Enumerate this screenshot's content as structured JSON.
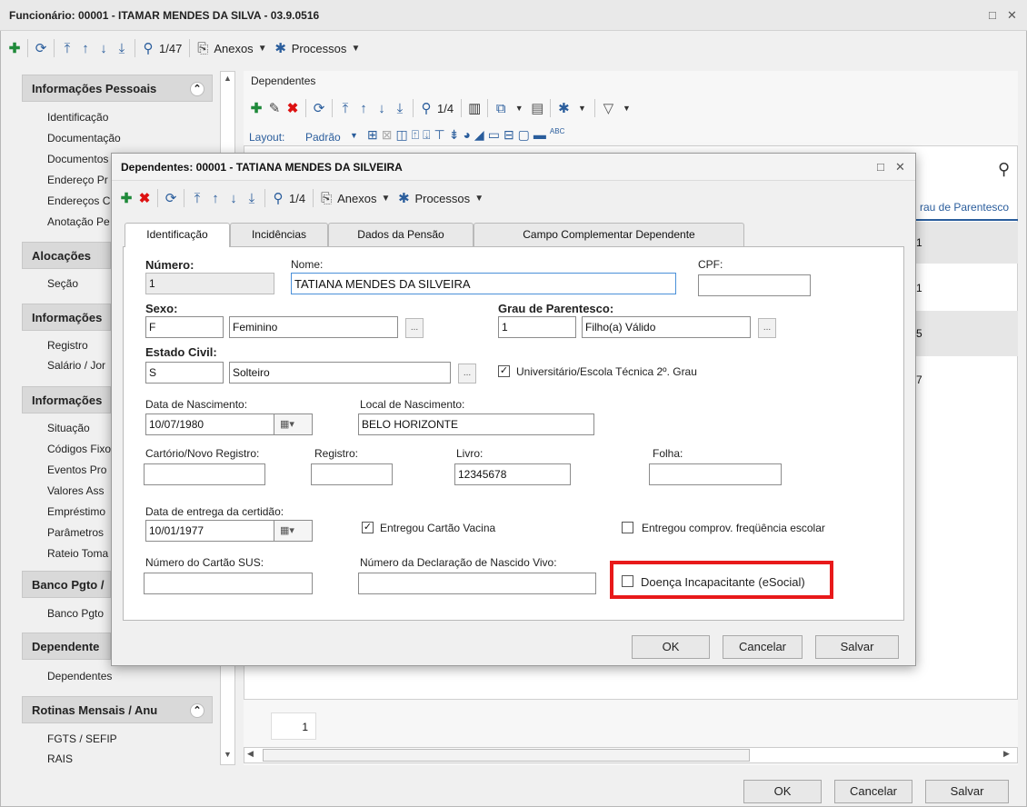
{
  "window": {
    "title": "Funcionário: 00001 - ITAMAR MENDES DA SILVA - 03.9.0516",
    "controls": {
      "restore": "□",
      "close": "✕"
    }
  },
  "main_toolbar": {
    "counter": "1/47",
    "anexos": "Anexos",
    "processos": "Processos"
  },
  "sidebar": {
    "sections": [
      {
        "title": "Informações Pessoais",
        "items": [
          "Identificação",
          "Documentação",
          "Documentos",
          "Endereço Pr",
          "Endereços C",
          "Anotação Pe"
        ]
      },
      {
        "title": "Alocações",
        "items": [
          "Seção"
        ]
      },
      {
        "title": "Informações",
        "items": [
          "Registro",
          "Salário / Jor"
        ]
      },
      {
        "title": "Informações",
        "items": [
          "Situação",
          "Códigos Fixo",
          "Eventos Pro",
          "Valores Ass",
          "Empréstimo",
          "Parâmetros",
          "Rateio Toma"
        ]
      },
      {
        "title": "Banco Pgto /",
        "items": [
          "Banco Pgto"
        ]
      },
      {
        "title": "Dependente",
        "items": [
          "Dependentes"
        ]
      },
      {
        "title": "Rotinas Mensais / Anu",
        "items": [
          "FGTS / SEFIP",
          "RAIS"
        ]
      }
    ]
  },
  "dependentes_panel": {
    "label": "Dependentes",
    "counter": "1/4",
    "layout_label": "Layout:",
    "layout_value": "Padrão",
    "column_header": "rau de Parentesco",
    "row_fragments": [
      "1",
      "1",
      "5",
      "7"
    ],
    "page_number": "1"
  },
  "main_buttons": {
    "ok": "OK",
    "cancel": "Cancelar",
    "save": "Salvar"
  },
  "dialog": {
    "title": "Dependentes: 00001 - TATIANA MENDES DA SILVEIRA",
    "controls": {
      "restore": "□",
      "close": "✕"
    },
    "counter": "1/4",
    "anexos": "Anexos",
    "processos": "Processos",
    "tabs": [
      "Identificação",
      "Incidências",
      "Dados da Pensão",
      "Campo Complementar Dependente"
    ],
    "form": {
      "numero_label": "Número:",
      "numero": "1",
      "nome_label": "Nome:",
      "nome": "TATIANA MENDES DA SILVEIRA",
      "cpf_label": "CPF:",
      "cpf": "",
      "sexo_label": "Sexo:",
      "sexo_code": "F",
      "sexo_desc": "Feminino",
      "grau_label": "Grau de Parentesco:",
      "grau_code": "1",
      "grau_desc": "Filho(a) Válido",
      "estado_label": "Estado Civil:",
      "estado_code": "S",
      "estado_desc": "Solteiro",
      "universitario_label": "Universitário/Escola Técnica 2º. Grau",
      "universitario_checked": true,
      "nascimento_label": "Data de Nascimento:",
      "nascimento": "10/07/1980",
      "local_label": "Local de Nascimento:",
      "local": "BELO HORIZONTE",
      "cartorio_label": "Cartório/Novo Registro:",
      "cartorio": "",
      "registro_label": "Registro:",
      "registro": "",
      "livro_label": "Livro:",
      "livro": "12345678",
      "folha_label": "Folha:",
      "folha": "",
      "entrega_label": "Data de entrega da certidão:",
      "entrega": "10/01/1977",
      "vacina_label": "Entregou Cartão Vacina",
      "vacina_checked": true,
      "escolar_label": "Entregou comprov. freqüência escolar",
      "escolar_checked": false,
      "sus_label": "Número do Cartão SUS:",
      "sus": "",
      "declaracao_label": "Número da Declaração de Nascido Vivo:",
      "declaracao": "",
      "doenca_label": "Doença Incapacitante (eSocial)",
      "doenca_checked": false
    },
    "buttons": {
      "ok": "OK",
      "cancel": "Cancelar",
      "save": "Salvar"
    }
  },
  "colors": {
    "highlight": "#e8191a",
    "accent_blue": "#2a5d9c",
    "add_green": "#1f8a3a",
    "delete_red": "#d11111"
  }
}
